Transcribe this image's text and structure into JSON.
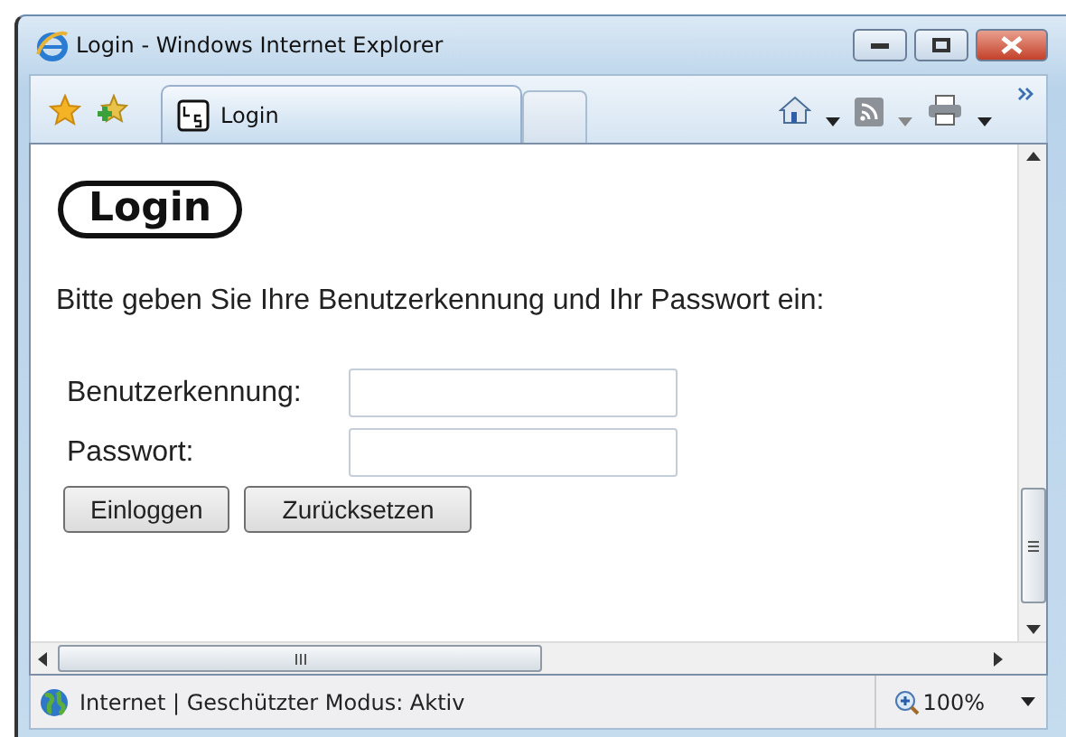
{
  "window": {
    "title": "Login - Windows Internet Explorer"
  },
  "tab": {
    "label": "Login"
  },
  "page": {
    "logo": "Login",
    "instruction": "Bitte geben Sie Ihre Benutzerkennung und Ihr Passwort ein:",
    "fields": [
      {
        "label": "Benutzerkennung:"
      },
      {
        "label": "Passwort:"
      }
    ],
    "buttons": [
      "Einloggen",
      "Zurücksetzen"
    ]
  },
  "status_bar": {
    "zone": "Internet | Geschützter Modus: Aktiv",
    "zoom": "100%"
  }
}
